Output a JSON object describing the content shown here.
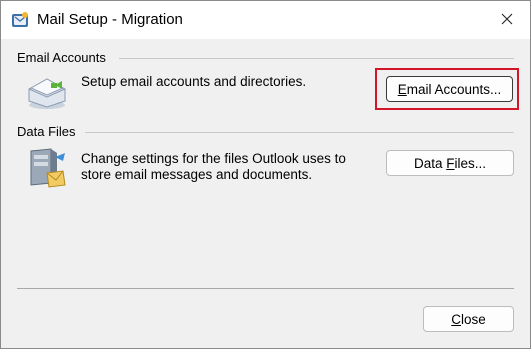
{
  "window": {
    "title": "Mail Setup - Migration"
  },
  "email_accounts": {
    "group_label": "Email Accounts",
    "description": "Setup email accounts and directories.",
    "button_pre": "",
    "button_accel": "E",
    "button_post": "mail Accounts..."
  },
  "data_files": {
    "group_label": "Data Files",
    "description_line1": "Change settings for the files Outlook uses to",
    "description_line2": "store email messages and documents.",
    "button_pre": "Data ",
    "button_accel": "F",
    "button_post": "iles..."
  },
  "footer": {
    "close_pre": "",
    "close_accel": "C",
    "close_post": "lose"
  },
  "colors": {
    "highlight": "#d3152a",
    "background": "#f0f0f0"
  },
  "icons": {
    "title": "outlook-mail-setup-icon",
    "close": "close-icon",
    "email": "envelope-icon",
    "datafiles": "data-files-icon"
  }
}
